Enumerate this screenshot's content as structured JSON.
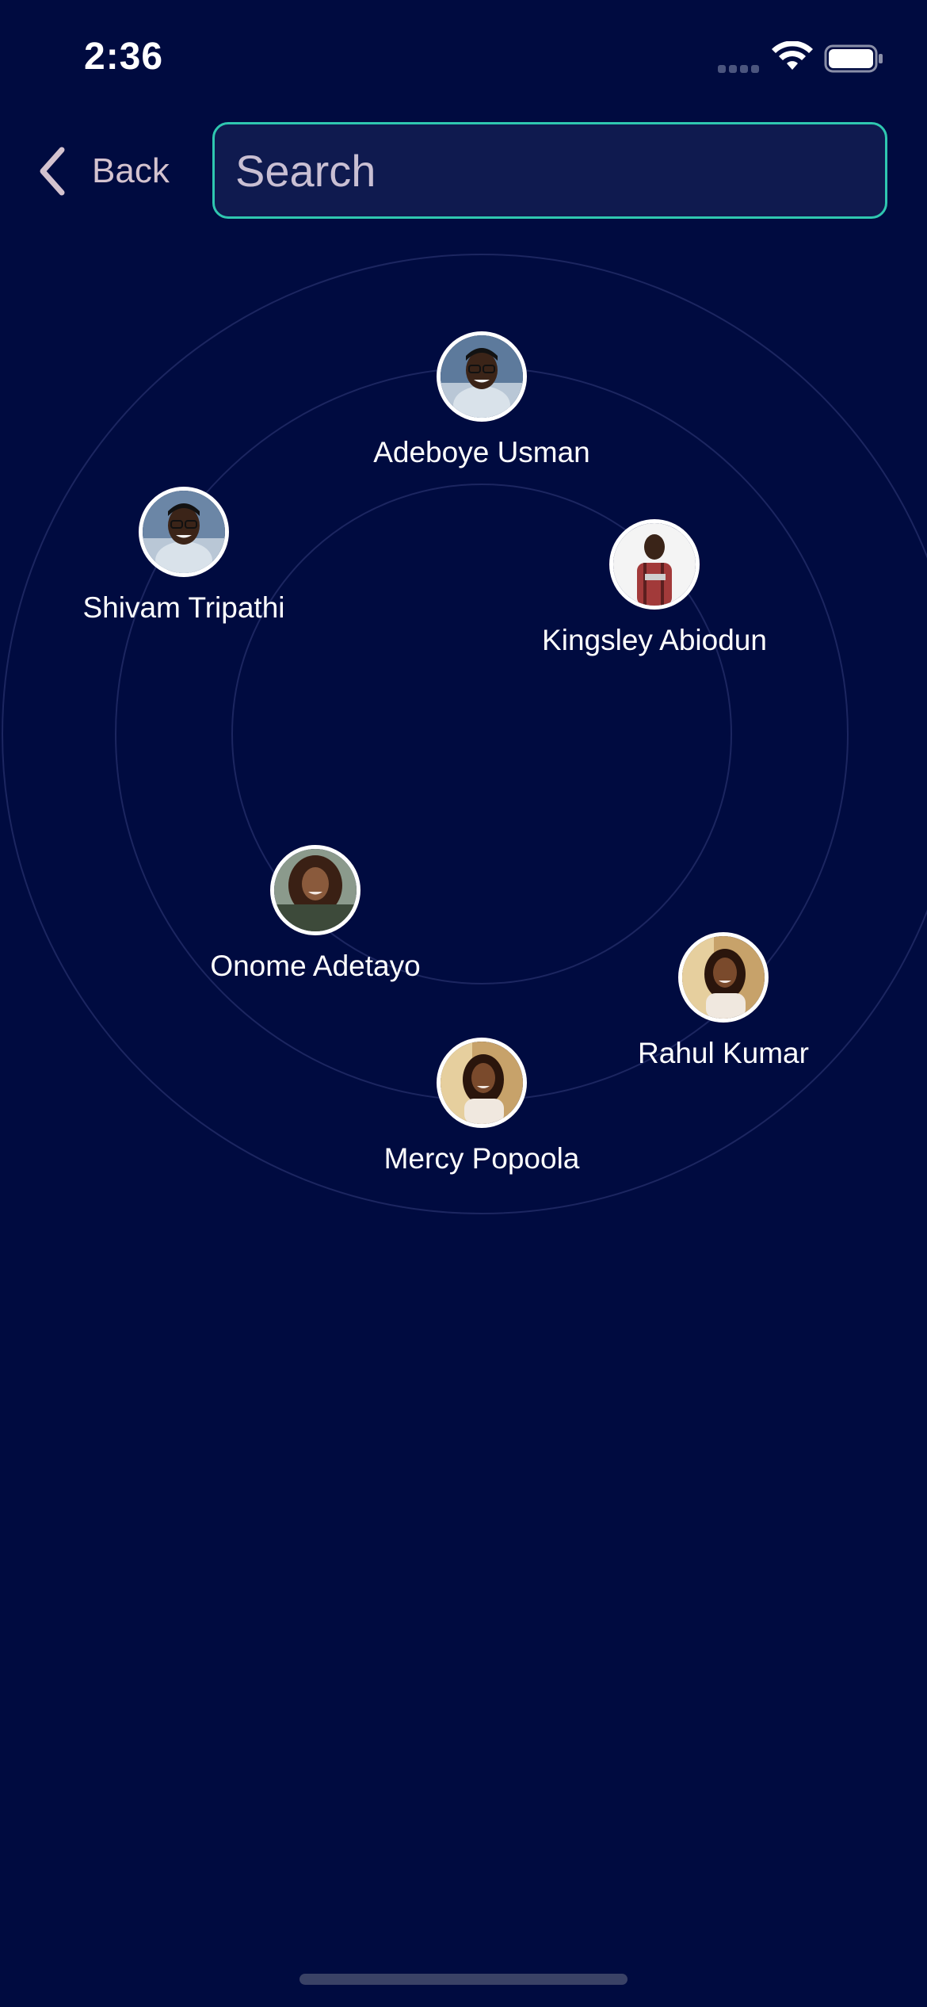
{
  "status_bar": {
    "time": "2:36",
    "wifi_icon": "wifi-icon",
    "battery_icon": "battery-icon"
  },
  "header": {
    "back_label": "Back",
    "back_icon": "chevron-left-icon",
    "search_placeholder": "Search",
    "search_value": ""
  },
  "colors": {
    "background": "#000b40",
    "search_border": "#2fc7b0",
    "search_fill": "#0f1a4f",
    "back_text": "#d4c3cf"
  },
  "people": [
    {
      "name": "Adeboye Usman"
    },
    {
      "name": "Shivam Tripathi"
    },
    {
      "name": "Kingsley Abiodun"
    },
    {
      "name": "Onome Adetayo"
    },
    {
      "name": "Rahul Kumar"
    },
    {
      "name": "Mercy Popoola"
    }
  ]
}
